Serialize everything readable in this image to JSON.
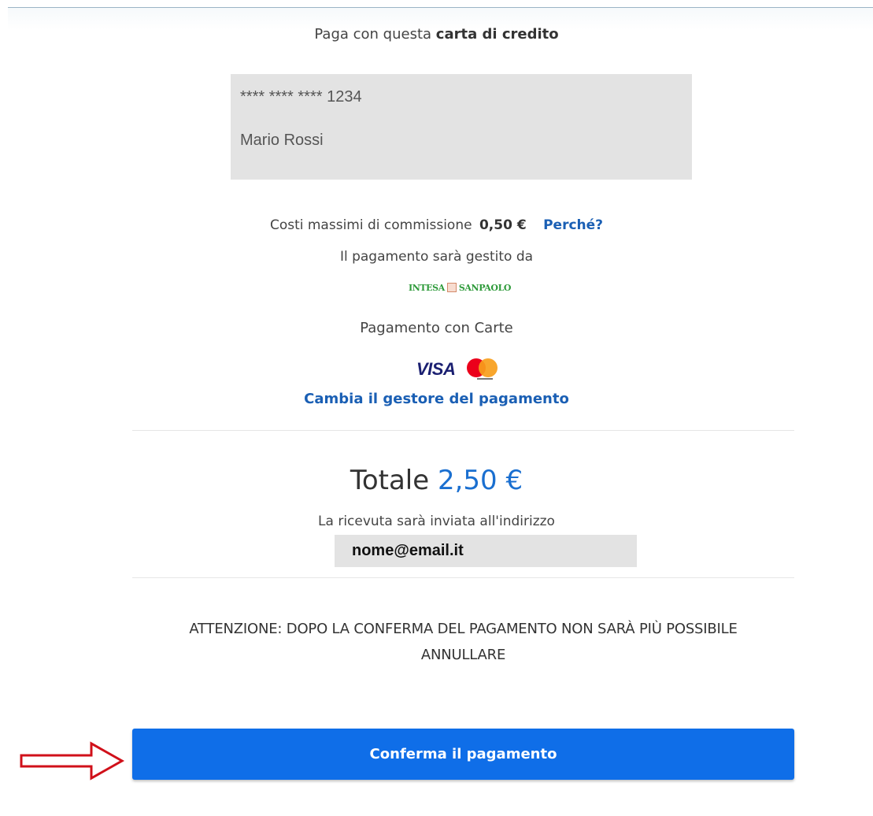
{
  "payment": {
    "heading_prefix": "Paga con questa",
    "heading_bold": "carta di credito"
  },
  "card": {
    "masked_number": "**** **** **** 1234",
    "holder": "Mario Rossi"
  },
  "fees": {
    "label": "Costi massimi di commissione",
    "amount": "0,50 €",
    "why_link": "Perché?"
  },
  "provider": {
    "managed_by": "Il pagamento sarà gestito da",
    "bank_left": "INTESA",
    "bank_right": "SANPAOLO",
    "method": "Pagamento con Carte",
    "brand_visa": "VISA",
    "change_link": "Cambia il gestore del pagamento"
  },
  "summary": {
    "total_label": "Totale",
    "total_amount": "2,50 €",
    "receipt_label": "La ricevuta sarà inviata all'indirizzo",
    "email": "nome@email.it"
  },
  "warning": {
    "line1": "ATTENZIONE: DOPO LA CONFERMA DEL PAGAMENTO NON SARÀ PIÙ POSSIBILE",
    "line2": "ANNULLARE"
  },
  "actions": {
    "confirm_label": "Conferma il pagamento"
  },
  "colors": {
    "primary_button": "#0f6ee8",
    "link": "#1a5fb4",
    "annotation_arrow": "#d0101a"
  }
}
